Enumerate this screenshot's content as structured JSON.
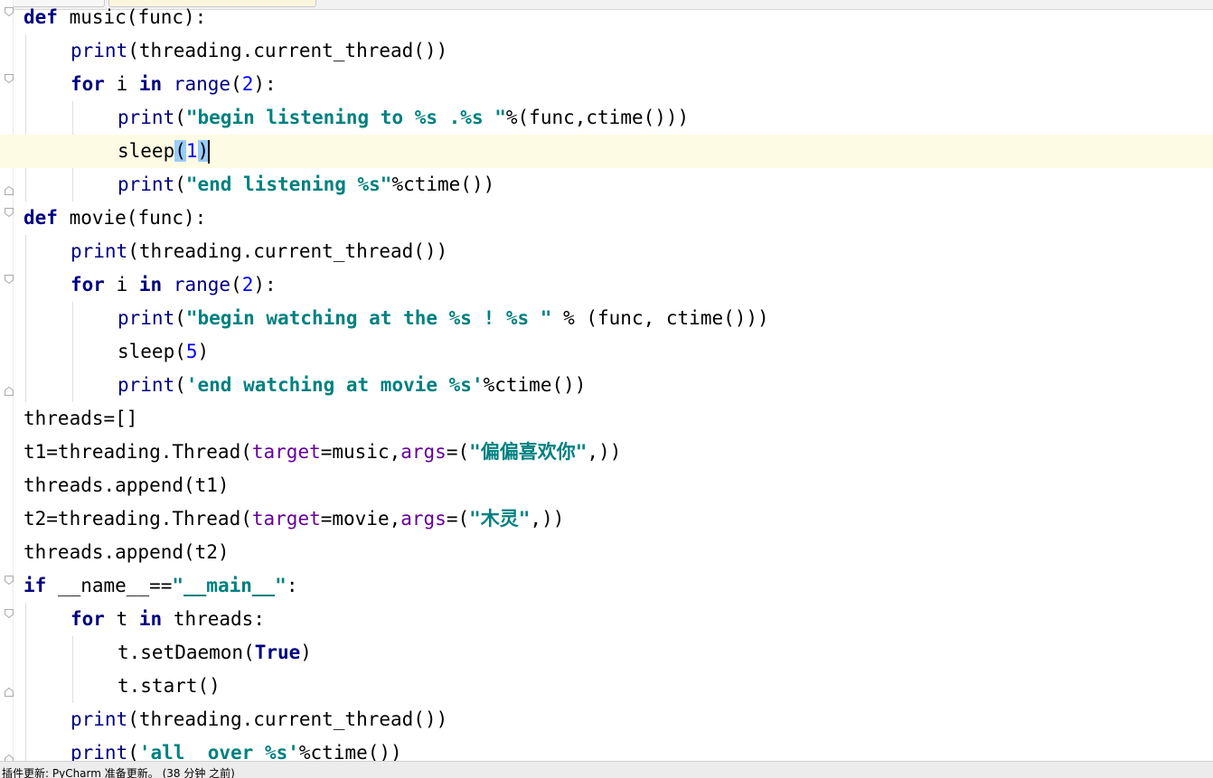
{
  "editor": {
    "language": "Python",
    "caret_line": 5,
    "lines": [
      {
        "indent": 0,
        "fold": "open",
        "tokens": [
          {
            "t": "def",
            "c": "kw"
          },
          {
            "t": " music(func):"
          }
        ]
      },
      {
        "indent": 1,
        "fold": null,
        "tokens": [
          {
            "t": "print",
            "c": "bi"
          },
          {
            "t": "(threading.current_thread())"
          }
        ]
      },
      {
        "indent": 1,
        "fold": "open",
        "tokens": [
          {
            "t": "for",
            "c": "kw"
          },
          {
            "t": " i "
          },
          {
            "t": "in",
            "c": "kw"
          },
          {
            "t": " "
          },
          {
            "t": "range",
            "c": "bi"
          },
          {
            "t": "("
          },
          {
            "t": "2",
            "c": "num"
          },
          {
            "t": "):"
          }
        ]
      },
      {
        "indent": 2,
        "fold": null,
        "tokens": [
          {
            "t": "print",
            "c": "bi"
          },
          {
            "t": "("
          },
          {
            "t": "\"begin listening to %s .%s \"",
            "c": "str"
          },
          {
            "t": "%(func,ctime()))"
          }
        ]
      },
      {
        "indent": 2,
        "fold": null,
        "current": true,
        "tokens": [
          {
            "t": "sleep"
          },
          {
            "t": "(",
            "c": "bracehl"
          },
          {
            "t": "1",
            "c": "num"
          },
          {
            "t": ")",
            "c": "bracehl"
          },
          {
            "t": "",
            "c": "caret"
          }
        ]
      },
      {
        "indent": 2,
        "fold": "end",
        "tokens": [
          {
            "t": "print",
            "c": "bi"
          },
          {
            "t": "("
          },
          {
            "t": "\"end listening %s\"",
            "c": "str"
          },
          {
            "t": "%ctime())"
          }
        ]
      },
      {
        "indent": 0,
        "fold": "open",
        "tokens": [
          {
            "t": "def",
            "c": "kw"
          },
          {
            "t": " movie(func):"
          }
        ]
      },
      {
        "indent": 1,
        "fold": null,
        "tokens": [
          {
            "t": "print",
            "c": "bi"
          },
          {
            "t": "(threading.current_thread())"
          }
        ]
      },
      {
        "indent": 1,
        "fold": "open",
        "tokens": [
          {
            "t": "for",
            "c": "kw"
          },
          {
            "t": " i "
          },
          {
            "t": "in",
            "c": "kw"
          },
          {
            "t": " "
          },
          {
            "t": "range",
            "c": "bi"
          },
          {
            "t": "("
          },
          {
            "t": "2",
            "c": "num"
          },
          {
            "t": "):"
          }
        ]
      },
      {
        "indent": 2,
        "fold": null,
        "tokens": [
          {
            "t": "print",
            "c": "bi"
          },
          {
            "t": "("
          },
          {
            "t": "\"begin watching at the %s ! %s \"",
            "c": "str"
          },
          {
            "t": " % (func, ctime()))"
          }
        ]
      },
      {
        "indent": 2,
        "fold": null,
        "tokens": [
          {
            "t": "sleep("
          },
          {
            "t": "5",
            "c": "num"
          },
          {
            "t": ")"
          }
        ]
      },
      {
        "indent": 2,
        "fold": "end",
        "tokens": [
          {
            "t": "print",
            "c": "bi"
          },
          {
            "t": "("
          },
          {
            "t": "'end watching at movie %s'",
            "c": "str"
          },
          {
            "t": "%ctime())"
          }
        ]
      },
      {
        "indent": 0,
        "fold": null,
        "tokens": [
          {
            "t": "threads=[]"
          }
        ]
      },
      {
        "indent": 0,
        "fold": null,
        "tokens": [
          {
            "t": "t1=threading.Thread("
          },
          {
            "t": "target",
            "c": "kwarg"
          },
          {
            "t": "=music,"
          },
          {
            "t": "args",
            "c": "kwarg"
          },
          {
            "t": "=("
          },
          {
            "t": "\"偏偏喜欢你\"",
            "c": "str"
          },
          {
            "t": ",))"
          }
        ]
      },
      {
        "indent": 0,
        "fold": null,
        "tokens": [
          {
            "t": "threads.append(t1)"
          }
        ]
      },
      {
        "indent": 0,
        "fold": null,
        "tokens": [
          {
            "t": "t2=threading.Thread("
          },
          {
            "t": "target",
            "c": "kwarg"
          },
          {
            "t": "=movie,"
          },
          {
            "t": "args",
            "c": "kwarg"
          },
          {
            "t": "=("
          },
          {
            "t": "\"木灵\"",
            "c": "str"
          },
          {
            "t": ",))"
          }
        ]
      },
      {
        "indent": 0,
        "fold": null,
        "tokens": [
          {
            "t": "threads.append(t2)"
          }
        ]
      },
      {
        "indent": 0,
        "fold": "open",
        "tokens": [
          {
            "t": "if",
            "c": "kw"
          },
          {
            "t": " __name__=="
          },
          {
            "t": "\"__main__\"",
            "c": "str"
          },
          {
            "t": ":"
          }
        ]
      },
      {
        "indent": 1,
        "fold": "open",
        "tokens": [
          {
            "t": "for",
            "c": "kw"
          },
          {
            "t": " t "
          },
          {
            "t": "in",
            "c": "kw"
          },
          {
            "t": " threads:"
          }
        ]
      },
      {
        "indent": 2,
        "fold": null,
        "tokens": [
          {
            "t": "t.setDaemon("
          },
          {
            "t": "True",
            "c": "kw"
          },
          {
            "t": ")"
          }
        ]
      },
      {
        "indent": 2,
        "fold": "end",
        "tokens": [
          {
            "t": "t.start()"
          }
        ]
      },
      {
        "indent": 1,
        "fold": null,
        "tokens": [
          {
            "t": "print",
            "c": "bi"
          },
          {
            "t": "(threading.current_thread())"
          }
        ]
      },
      {
        "indent": 1,
        "fold": "end",
        "tokens": [
          {
            "t": "print",
            "c": "bi"
          },
          {
            "t": "("
          },
          {
            "t": "'all  over %s'",
            "c": "str"
          },
          {
            "t": "%ctime())"
          }
        ]
      }
    ]
  },
  "statusbar": {
    "text": "插件更新: PyCharm 准备更新。 (38 分钟 之前)"
  }
}
